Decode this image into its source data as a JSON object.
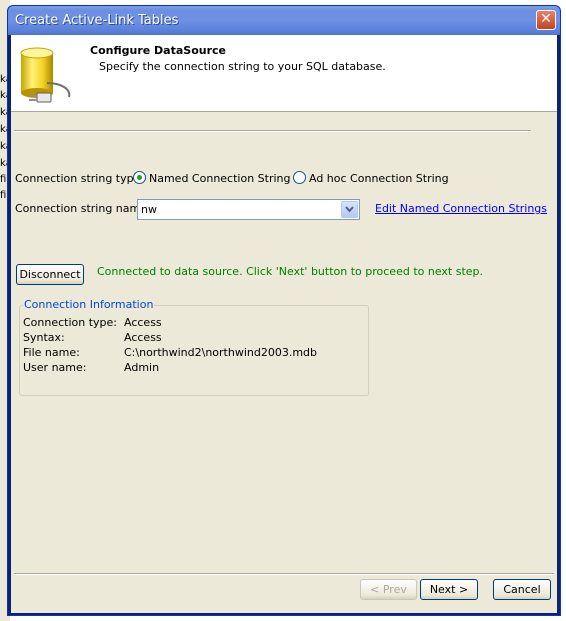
{
  "window": {
    "title": "Create Active-Link Tables",
    "close_glyph": "✕"
  },
  "header": {
    "title": "Configure DataSource",
    "subtitle": "Specify the connection string to your SQL database.",
    "icon": "database-plug-icon"
  },
  "background_fragments": [
    "ka",
    "ka",
    "ka",
    "ka",
    "ka",
    "ka",
    "file",
    "file"
  ],
  "form": {
    "type_label": "Connection string type:",
    "type_options": [
      {
        "label": "Named Connection String",
        "selected": true
      },
      {
        "label": "Ad hoc Connection String",
        "selected": false
      }
    ],
    "name_label": "Connection string name:",
    "name_value": "nw",
    "edit_link": "Edit Named Connection Strings"
  },
  "connection": {
    "button_label": "Disconnect",
    "status": "Connected to data source. Click 'Next' button to proceed to next step."
  },
  "info": {
    "legend": "Connection Information",
    "rows": [
      {
        "label": "Connection type:",
        "value": "Access"
      },
      {
        "label": "Syntax:",
        "value": "Access"
      },
      {
        "label": "File name:",
        "value": "C:\\northwind2\\northwind2003.mdb"
      },
      {
        "label": "User name:",
        "value": "Admin"
      }
    ]
  },
  "footer": {
    "prev_label": "< Prev",
    "next_label": "Next >",
    "cancel_label": "Cancel"
  },
  "colors": {
    "title_bar": "#6e91e3",
    "status_text": "#008000",
    "link": "#0000ff",
    "legend": "#0046d5"
  }
}
